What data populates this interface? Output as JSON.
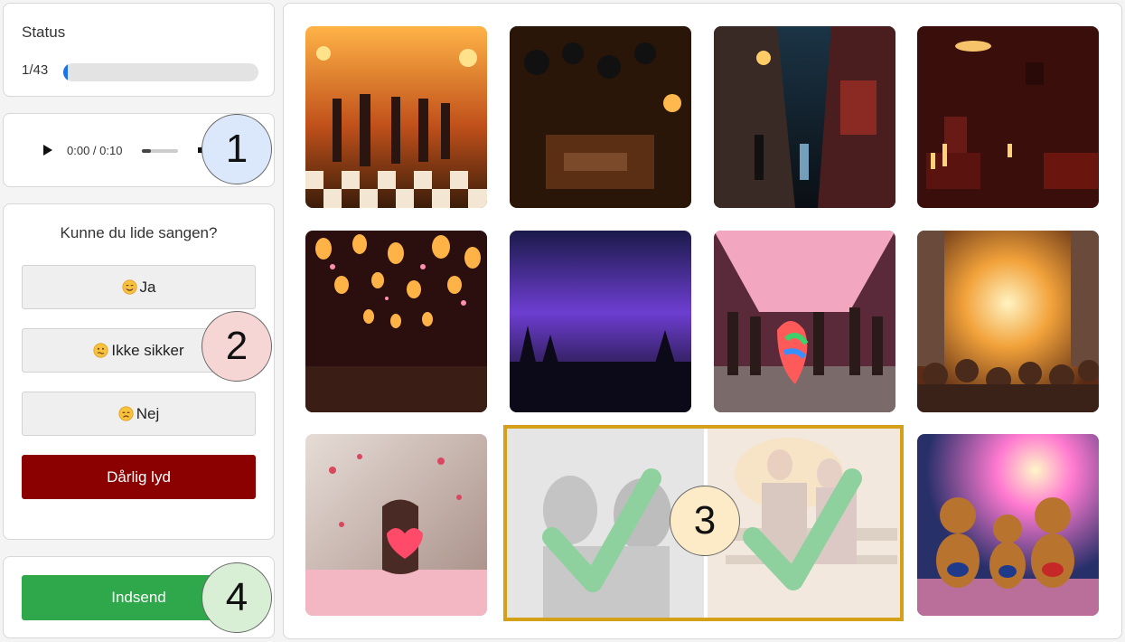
{
  "status": {
    "label": "Status",
    "progress_text": "1/43",
    "progress_fraction": 0.0233
  },
  "audio": {
    "time": "0:00 / 0:10",
    "icons": [
      "play-icon",
      "volume-icon"
    ]
  },
  "question": {
    "text": "Kunne du lide sangen?",
    "options": [
      {
        "label": "Ja",
        "icon": "smiling-face-icon"
      },
      {
        "label": "Ikke sikker",
        "icon": "confused-face-icon"
      },
      {
        "label": "Nej",
        "icon": "sad-face-icon"
      }
    ],
    "bad_sound_label": "Dårlig lyd"
  },
  "submit": {
    "label": "Indsend"
  },
  "images": [
    {
      "name": "retro-dance-hall-image"
    },
    {
      "name": "record-room-image"
    },
    {
      "name": "neon-alley-image"
    },
    {
      "name": "candlelit-lounge-image"
    },
    {
      "name": "lantern-street-image"
    },
    {
      "name": "purple-night-forest-image"
    },
    {
      "name": "street-party-image"
    },
    {
      "name": "sunset-crowd-image"
    },
    {
      "name": "petals-heart-image"
    },
    {
      "name": "vintage-women-image",
      "selected": true
    },
    {
      "name": "couple-bench-image",
      "selected": true
    },
    {
      "name": "teddy-bear-band-image"
    }
  ],
  "callouts": [
    "1",
    "2",
    "3",
    "4"
  ],
  "colors": {
    "progress": "#1a73e8",
    "bad_sound": "#8b0000",
    "submit": "#2ea84a",
    "selection": "#d4a017",
    "check": "#8fd19e",
    "callout_1": "#dbe8fb",
    "callout_2": "#f6d5d5",
    "callout_3": "#fdebc8",
    "callout_4": "#d9efd5"
  }
}
